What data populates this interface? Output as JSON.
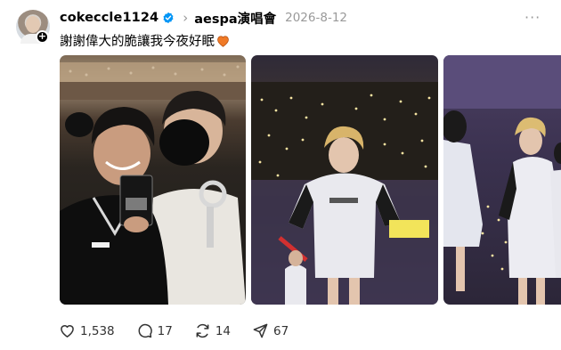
{
  "post": {
    "username": "cokeccle1124",
    "topic": "aespa演唱會",
    "date": "2026-8-12",
    "caption": "謝謝偉大的脆讓我今夜好眠",
    "more_label": "···",
    "follow_symbol": "+"
  },
  "icons": {
    "verified": "verified-badge-icon",
    "topic_chevron": "chevron-right-icon",
    "caption_emoji": "orange-heart-icon",
    "like": "heart-icon",
    "reply": "comment-icon",
    "repost": "repost-icon",
    "share": "send-icon",
    "more": "more-dots-icon"
  },
  "colors": {
    "text_primary": "#000000",
    "text_secondary": "#999999",
    "verified_blue": "#0095f6",
    "emoji_orange": "#f07a26"
  },
  "stats": {
    "likes": "1,538",
    "replies": "17",
    "reposts": "14",
    "shares": "67"
  }
}
